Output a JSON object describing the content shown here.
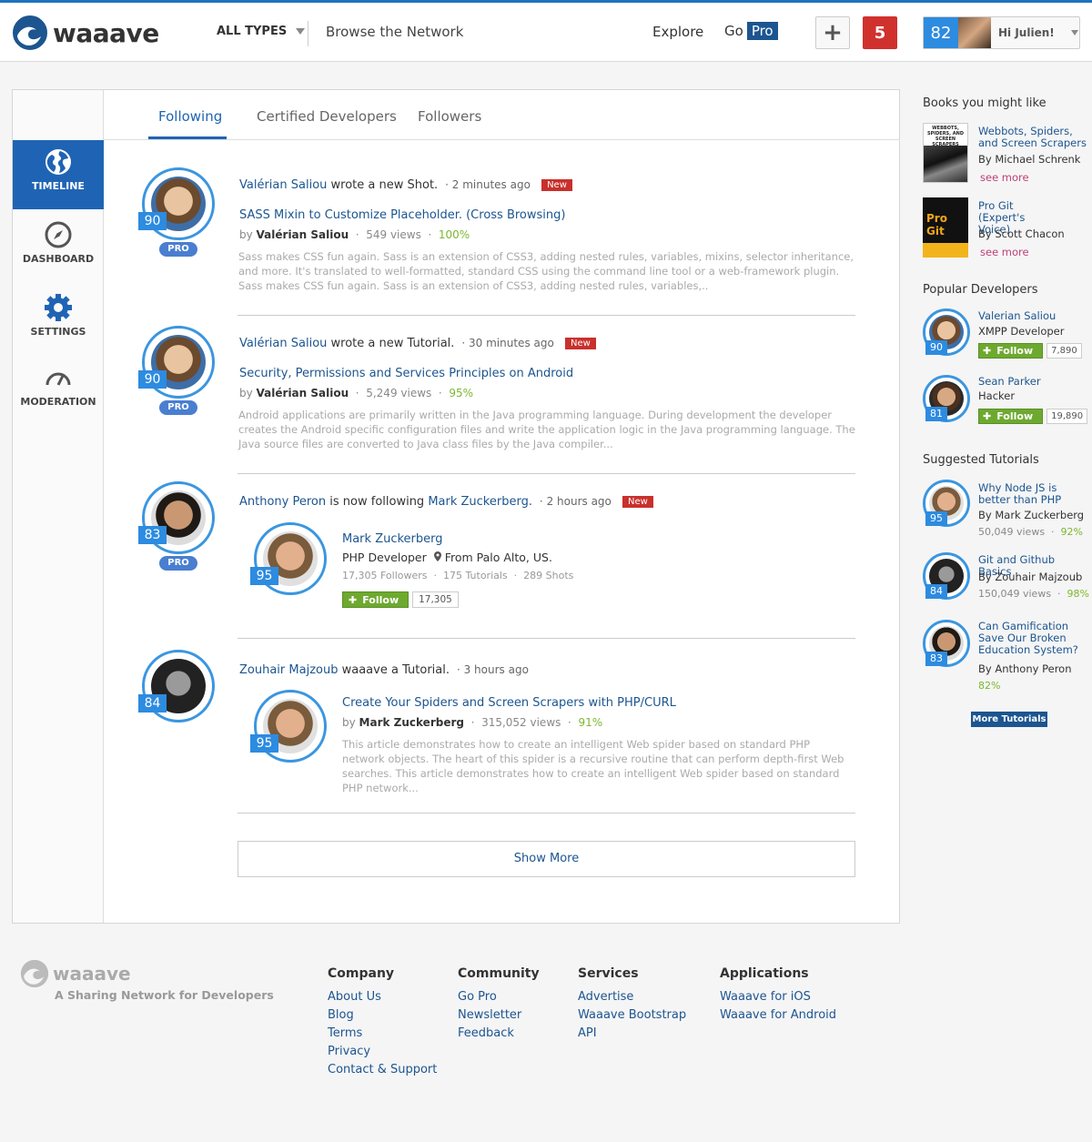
{
  "header": {
    "logo_text": "waaave",
    "types_label": "ALL TYPES",
    "browse_label": "Browse the Network",
    "explore_label": "Explore",
    "go_label": "Go",
    "pro_label": "Pro",
    "add_label": "+",
    "notifications_count": "5",
    "user_score": "82",
    "greeting": "Hi Julien!"
  },
  "nav": {
    "timeline": "TIMELINE",
    "dashboard": "DASHBOARD",
    "settings": "SETTINGS",
    "moderation": "MODERATION"
  },
  "tabs": [
    "Following",
    "Certified Developers",
    "Followers"
  ],
  "feed": [
    {
      "score": "90",
      "badge": "PRO",
      "actor": "Valérian Saliou",
      "action": "wrote a new Shot.",
      "time": "2 minutes ago",
      "new_label": "New",
      "title": "SASS Mixin to Customize Placeholder. (Cross Browsing)",
      "by": "by",
      "author": "Valérian Saliou",
      "views": "549 views",
      "pct": "100%",
      "desc": "Sass makes CSS fun again. Sass is an extension of CSS3, adding nested rules, variables, mixins, selector inheritance, and more. It's translated to well-formatted, standard CSS using the command line tool or a web-framework plugin. Sass makes CSS fun again. Sass is an extension of CSS3, adding nested rules, variables,.."
    },
    {
      "score": "90",
      "badge": "PRO",
      "actor": "Valérian Saliou",
      "action": "wrote a new Tutorial.",
      "time": "30 minutes ago",
      "new_label": "New",
      "title": "Security, Permissions and Services Principles on Android",
      "by": "by",
      "author": "Valérian Saliou",
      "views": "5,249 views",
      "pct": "95%",
      "desc": "Android applications are primarily written in the Java programming language. During development the developer creates the Android specific configuration files and write the application logic in the Java programming language. The Java source files are converted to Java class files by the Java compiler..."
    },
    {
      "score": "83",
      "badge": "PRO",
      "actor": "Anthony Peron",
      "action": "is now following",
      "target": "Mark Zuckerberg.",
      "time": "2 hours ago",
      "new_label": "New",
      "card": {
        "score": "95",
        "name": "Mark Zuckerberg",
        "role": "PHP Developer",
        "location": "From Palo Alto, US.",
        "followers": "17,305 Followers",
        "tutorials": "175 Tutorials",
        "shots": "289 Shots",
        "follow_label": "Follow",
        "follow_count": "17,305"
      }
    },
    {
      "score": "84",
      "actor": "Zouhair Majzoub",
      "action": "waaave a Tutorial.",
      "time": "3 hours ago",
      "card": {
        "score": "95",
        "title": "Create Your Spiders and Screen Scrapers with PHP/CURL",
        "by": "by",
        "author": "Mark Zuckerberg",
        "views": "315,052 views",
        "pct": "91%",
        "desc": "This article demonstrates how to create an intelligent Web spider based on standard PHP network objects. The heart of this spider is a recursive routine that can perform depth-first Web searches. This article demonstrates how to create an intelligent Web spider based on standard PHP network..."
      }
    }
  ],
  "show_more": "Show More",
  "sidebar": {
    "books_heading": "Books you might like",
    "books": [
      {
        "title": "Webbots, Spiders, and Screen Scrapers",
        "author": "By Michael Schrenk",
        "more": "see more",
        "cover_text": "WEBBOTS, SPIDERS, AND SCREEN SCRAPERS"
      },
      {
        "title": "Pro Git (Expert's Voice)",
        "author": "By Scott Chacon",
        "more": "see more",
        "cover_text": "Pro Git"
      }
    ],
    "devs_heading": "Popular Developers",
    "devs": [
      {
        "score": "90",
        "name": "Valerian Saliou",
        "role": "XMPP Developer",
        "follow_label": "Follow",
        "count": "7,890"
      },
      {
        "score": "81",
        "name": "Sean Parker",
        "role": "Hacker",
        "follow_label": "Follow",
        "count": "19,890"
      }
    ],
    "tutorials_heading": "Suggested Tutorials",
    "tutorials": [
      {
        "score": "95",
        "title": "Why Node JS is better than PHP",
        "author": "By Mark Zuckerberg",
        "views": "50,049 views",
        "pct": "92%"
      },
      {
        "score": "84",
        "title": "Git and Github Basics",
        "author": "By Zouhair Majzoub",
        "views": "150,049 views",
        "pct": "98%"
      },
      {
        "score": "83",
        "title": "Can Gamification Save Our Broken Education System?",
        "author": "By Anthony Peron",
        "views": "",
        "pct": "82%"
      }
    ],
    "more_tutorials": "More Tutorials"
  },
  "footer": {
    "logo_text": "waaave",
    "tagline": "A Sharing Network for Developers",
    "columns": [
      {
        "heading": "Company",
        "links": [
          "About Us",
          "Blog",
          "Terms",
          "Privacy",
          "Contact & Support"
        ]
      },
      {
        "heading": "Community",
        "links": [
          "Go Pro",
          "Newsletter",
          "Feedback"
        ]
      },
      {
        "heading": "Services",
        "links": [
          "Advertise",
          "Waaave Bootstrap",
          "API"
        ]
      },
      {
        "heading": "Applications",
        "links": [
          "Waaave for iOS",
          "Waaave for Android"
        ]
      }
    ]
  },
  "colors": {
    "brand_blue": "#1c5590",
    "accent_blue": "#2d8be0",
    "new_red": "#c9302c",
    "follow_green": "#6ea92f",
    "pct_green": "#7cb82f"
  }
}
